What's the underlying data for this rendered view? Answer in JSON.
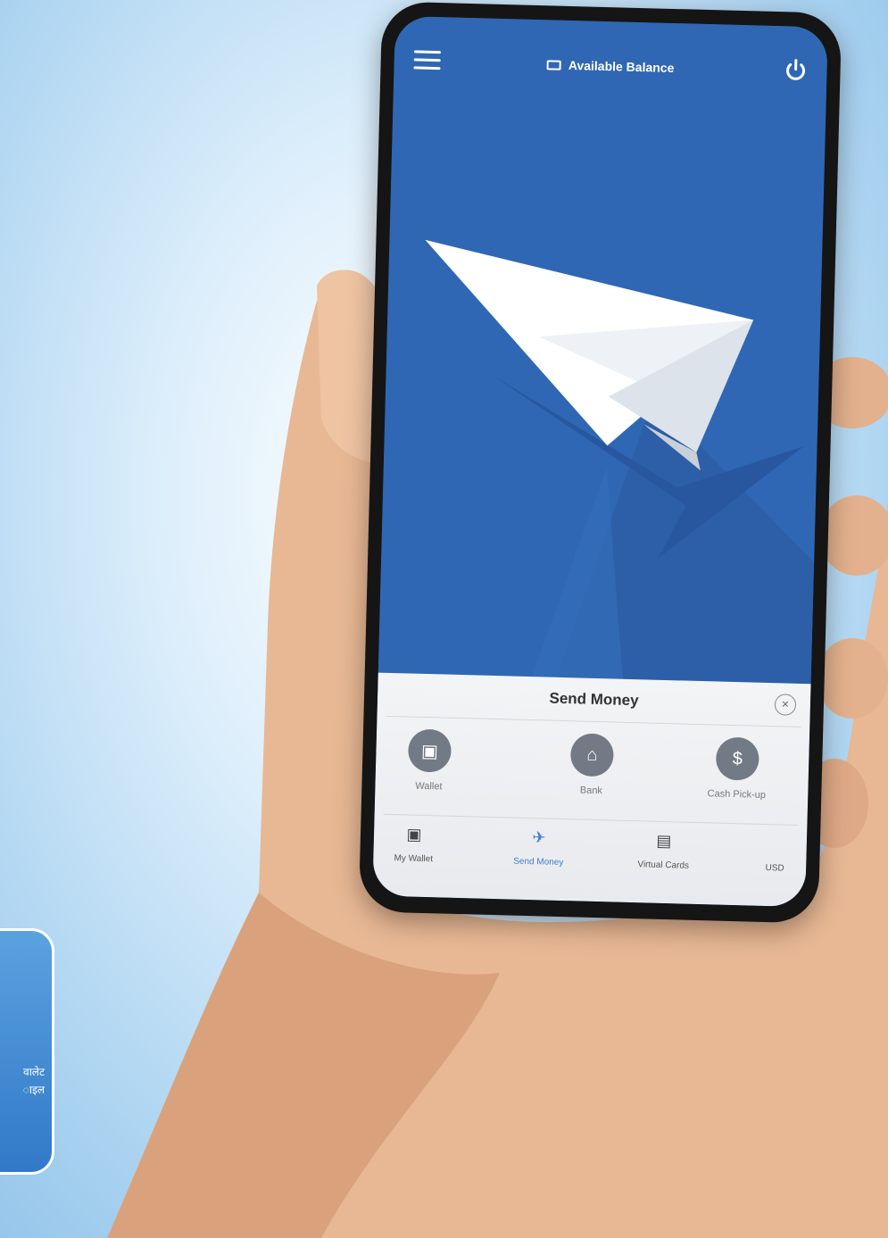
{
  "header": {
    "balance_label": "Available Balance"
  },
  "send_sheet": {
    "title": "Send Money",
    "options": [
      {
        "label": "Wallet",
        "icon": "wallet-icon"
      },
      {
        "label": "Bank",
        "icon": "bank-icon"
      },
      {
        "label": "Cash Pick-up",
        "icon": "cash-bag-icon"
      }
    ]
  },
  "bottom_nav": {
    "items": [
      {
        "label": "My Wallet",
        "icon": "wallet-icon"
      },
      {
        "label": "Send Money",
        "icon": "paper-plane-icon",
        "active": true
      },
      {
        "label": "Virtual Cards",
        "icon": "card-icon"
      },
      {
        "label": "USD",
        "icon": ""
      }
    ]
  },
  "callout": {
    "line1": "वालेट",
    "line2": "ाइल"
  },
  "colors": {
    "screen_blue": "#2f67b4",
    "active_nav": "#3b7fd6",
    "option_circle": "#727a85"
  }
}
